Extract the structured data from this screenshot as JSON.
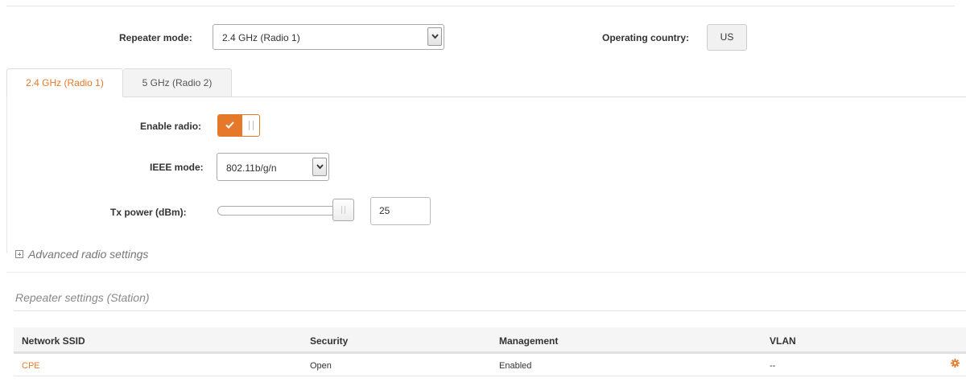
{
  "header": {
    "repeater_mode_label": "Repeater mode:",
    "repeater_mode_value": "2.4 GHz (Radio 1)",
    "operating_country_label": "Operating country:",
    "operating_country_value": "US"
  },
  "tabs": [
    {
      "label": "2.4 GHz (Radio 1)",
      "active": true
    },
    {
      "label": "5 GHz (Radio 2)",
      "active": false
    }
  ],
  "radio": {
    "enable_label": "Enable radio:",
    "enabled": true,
    "ieee_label": "IEEE mode:",
    "ieee_value": "802.11b/g/n",
    "tx_label": "Tx power (dBm):",
    "tx_value": "25",
    "tx_slider_fraction": 1.0
  },
  "advanced": {
    "label": "Advanced radio settings"
  },
  "repeater": {
    "title": "Repeater settings (Station)",
    "columns": [
      "Network SSID",
      "Security",
      "Management",
      "VLAN"
    ],
    "rows": [
      {
        "ssid": "CPE",
        "security": "Open",
        "management": "Enabled",
        "vlan": "--"
      }
    ]
  },
  "colors": {
    "accent": "#e57929"
  },
  "icons": {
    "settings": "gear-icon",
    "expand": "plus-box-icon",
    "check": "check-icon",
    "dropdown": "chevron-down-icon"
  }
}
